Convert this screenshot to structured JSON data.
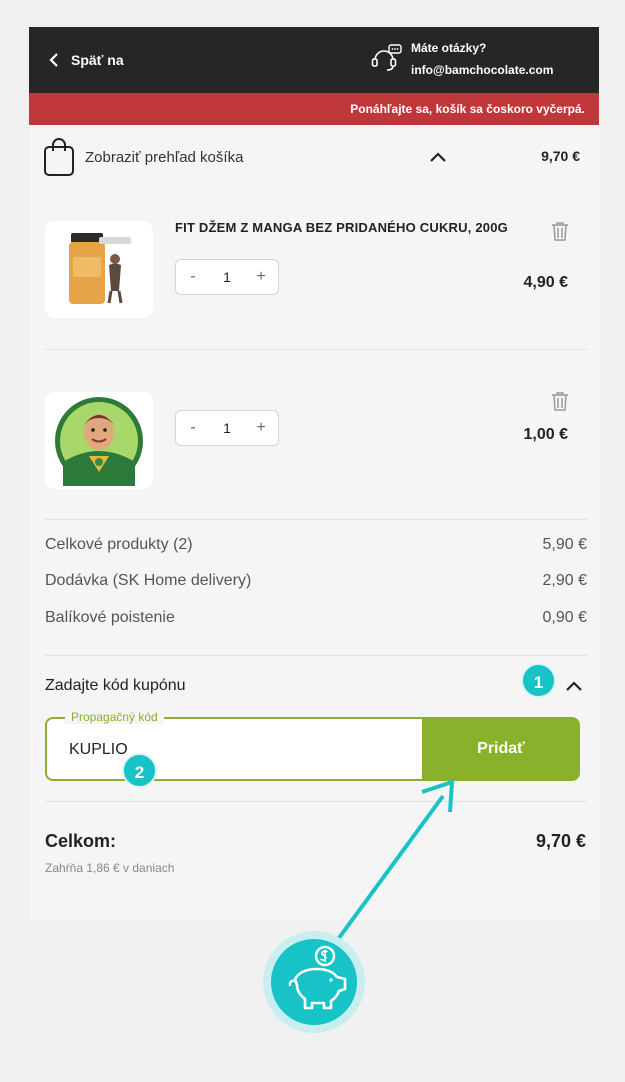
{
  "header": {
    "back_label": "Späť na",
    "help_question": "Máte otázky?",
    "help_email": "info@bamchocolate.com"
  },
  "alert": {
    "text": "Ponáhľajte sa, košík sa čoskoro vyčerpá."
  },
  "summary": {
    "label": "Zobraziť prehľad košíka",
    "total": "9,70 €"
  },
  "cart": {
    "items": [
      {
        "title": "FIT DŽEM Z MANGA BEZ PRIDANÉHO CUKRU, 200G",
        "quantity": "1",
        "price": "4,90 €",
        "minus": "-",
        "plus": "+"
      },
      {
        "title": "",
        "quantity": "1",
        "price": "1,00 €",
        "minus": "-",
        "plus": "+"
      }
    ]
  },
  "totals": {
    "products_label": "Celkové produkty (2)",
    "products_value": "5,90 €",
    "delivery_label": "Dodávka (SK Home delivery)",
    "delivery_value": "2,90 €",
    "insurance_label": "Balíkové poistenie",
    "insurance_value": "0,90 €"
  },
  "coupon": {
    "label": "Zadajte kód kupónu",
    "field_legend": "Propagačný kód",
    "value": "KUPLIO",
    "button": "Pridať"
  },
  "grand_total": {
    "label": "Celkom:",
    "value": "9,70 €",
    "tax_note": "Zahŕňa 1,86 € v daniach"
  },
  "annotations": {
    "badge1": "1",
    "badge2": "2"
  },
  "colors": {
    "accent_green": "#8ab12b",
    "alert_red": "#c0373a",
    "annotation_teal": "#17c3c7",
    "header_dark": "#262626"
  }
}
